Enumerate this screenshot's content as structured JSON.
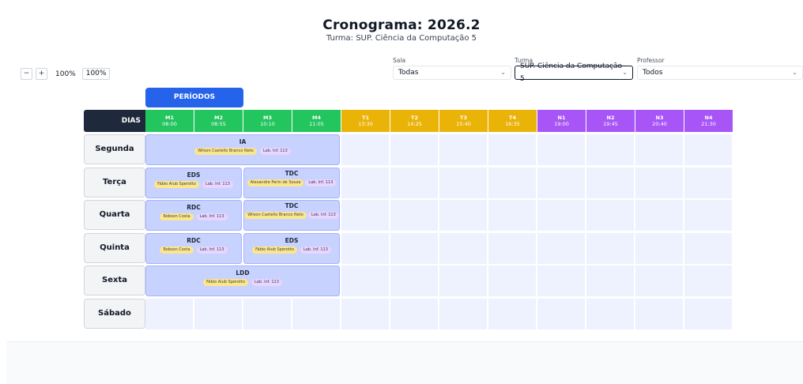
{
  "header": {
    "title": "Cronograma: 2026.2",
    "subtitle": "Turma: SUP. Ciência da Computação 5"
  },
  "zoom": {
    "minus": "−",
    "plus": "+",
    "level": "100%",
    "reset": "100%"
  },
  "filters": {
    "sala": {
      "label": "Sala",
      "value": "Todas"
    },
    "turma": {
      "label": "Turma",
      "value": "SUP. Ciência da Computação 5"
    },
    "professor": {
      "label": "Professor",
      "value": "Todos"
    }
  },
  "periodos_label": "PERÍODOS",
  "dias_label": "DIAS",
  "slots": [
    {
      "code": "M1",
      "time": "08:00",
      "group": "m"
    },
    {
      "code": "M2",
      "time": "08:55",
      "group": "m"
    },
    {
      "code": "M3",
      "time": "10:10",
      "group": "m"
    },
    {
      "code": "M4",
      "time": "11:05",
      "group": "m"
    },
    {
      "code": "T1",
      "time": "13:30",
      "group": "t"
    },
    {
      "code": "T2",
      "time": "14:25",
      "group": "t"
    },
    {
      "code": "T3",
      "time": "15:40",
      "group": "t"
    },
    {
      "code": "T4",
      "time": "16:35",
      "group": "t"
    },
    {
      "code": "N1",
      "time": "19:00",
      "group": "n"
    },
    {
      "code": "N2",
      "time": "19:45",
      "group": "n"
    },
    {
      "code": "N3",
      "time": "20:40",
      "group": "n"
    },
    {
      "code": "N4",
      "time": "21:30",
      "group": "n"
    }
  ],
  "days": [
    "Segunda",
    "Terça",
    "Quarta",
    "Quinta",
    "Sexta",
    "Sábado"
  ],
  "classes": [
    {
      "day": 0,
      "start": 0,
      "span": 4,
      "name": "IA",
      "prof": "Wilson Castello Branco Neto",
      "lab": "Lab. Inf. 113"
    },
    {
      "day": 1,
      "start": 0,
      "span": 2,
      "name": "EDS",
      "prof": "Fábio Aiub Sperotto",
      "lab": "Lab. Inf. 113"
    },
    {
      "day": 1,
      "start": 2,
      "span": 2,
      "name": "TDC",
      "prof": "Alexandre Perin de Souza",
      "lab": "Lab. Inf. 113"
    },
    {
      "day": 2,
      "start": 0,
      "span": 2,
      "name": "RDC",
      "prof": "Robson Costa",
      "lab": "Lab. Inf. 113"
    },
    {
      "day": 2,
      "start": 2,
      "span": 2,
      "name": "TDC",
      "prof": "Wilson Castello Branco Neto",
      "lab": "Lab. Inf. 113"
    },
    {
      "day": 3,
      "start": 0,
      "span": 2,
      "name": "RDC",
      "prof": "Robson Costa",
      "lab": "Lab. Inf. 113"
    },
    {
      "day": 3,
      "start": 2,
      "span": 2,
      "name": "EDS",
      "prof": "Fábio Aiub Sperotto",
      "lab": "Lab. Inf. 113"
    },
    {
      "day": 4,
      "start": 0,
      "span": 4,
      "name": "LDD",
      "prof": "Fábio Aiub Sperotto",
      "lab": "Lab. Inf. 113"
    }
  ],
  "colors": {
    "morning": "#22c55e",
    "afternoon": "#eab308",
    "night": "#a855f7",
    "periodos": "#2563eb",
    "dias": "#1e293b"
  }
}
